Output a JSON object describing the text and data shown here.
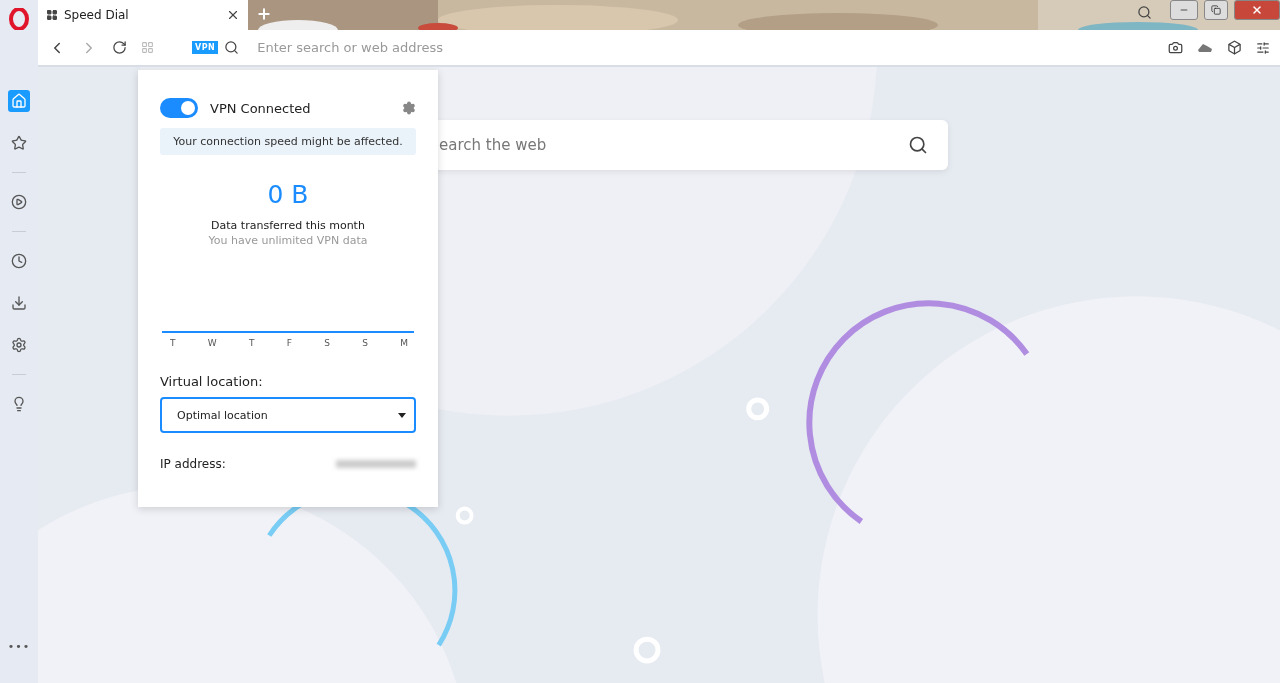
{
  "tab": {
    "title": "Speed Dial",
    "selected": true
  },
  "address_bar": {
    "vpn_badge": "VPN",
    "placeholder": "Enter search or web address"
  },
  "sidebar": {
    "items": [
      {
        "kind": "home",
        "selected": true
      },
      {
        "kind": "star",
        "selected": false
      },
      {
        "kind": "divider"
      },
      {
        "kind": "play",
        "selected": false
      },
      {
        "kind": "divider"
      },
      {
        "kind": "clock",
        "selected": false
      },
      {
        "kind": "download",
        "selected": false
      },
      {
        "kind": "gear",
        "selected": false
      },
      {
        "kind": "divider"
      },
      {
        "kind": "bulb",
        "selected": false
      }
    ],
    "more": "•••"
  },
  "page_search": {
    "placeholder": "earch the web"
  },
  "vpn_popup": {
    "on": true,
    "status": "VPN Connected",
    "notice": "Your connection speed might be affected.",
    "data_amount": "0 B",
    "data_label": "Data transferred this month",
    "data_sub": "You have unlimited VPN data",
    "days": [
      "T",
      "W",
      "T",
      "F",
      "S",
      "S",
      "M"
    ],
    "location_label": "Virtual location:",
    "location": "Optimal location",
    "ip_label": "IP address:"
  }
}
